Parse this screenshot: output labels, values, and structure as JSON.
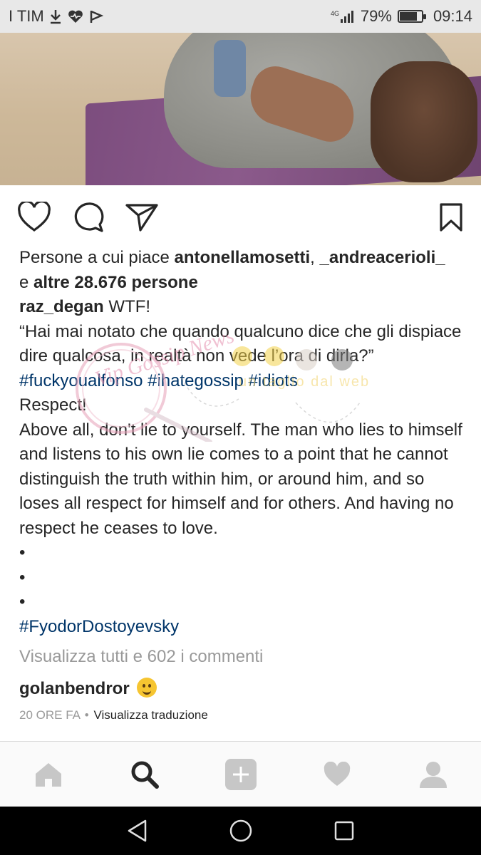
{
  "status_bar": {
    "carrier": "I TIM",
    "network": "4G",
    "battery_percent": "79%",
    "battery_level": 0.79,
    "time": "09:14"
  },
  "post": {
    "likes": {
      "prefix": "Persone a cui piace ",
      "user1": "antonellamosetti",
      "comma": ", ",
      "user2": "_andreacerioli_",
      "conjunction": "e ",
      "others": "altre 28.676 persone"
    },
    "caption": {
      "username": "raz_degan",
      "first_line": " WTF!",
      "quote": "“Hai mai notato che quando qualcuno dice che gli dispiace dire qualcosa, in realtà non vede l’ora di dirla?”",
      "hashtags_1": [
        "#fuckyoualfonso",
        "#ihategossip",
        "#idiots"
      ],
      "respect": "Respect!",
      "body": "Above all, don't lie to yourself. The man who lies to himself and listens to his own lie comes to a point that he cannot distinguish the truth within him, or around him, and so loses all respect for himself and for others. And having no respect he ceases to love.",
      "dots": [
        "•",
        "•",
        "•"
      ],
      "closing_hashtag": "#FyodorDostoyevsky"
    },
    "view_all_comments": "Visualizza tutti e 602 i commenti",
    "comment": {
      "username": "golanbendror",
      "emoji": "smiling-face-emoji"
    },
    "timestamp": "20 ORE FA",
    "separator": "•",
    "translate": "Visualizza traduzione"
  },
  "watermark": {
    "text1": "Vip Gossip News",
    "text2": "un taglio dal web"
  },
  "colors": {
    "hashtag": "#003569",
    "text": "#262626",
    "muted": "#999999",
    "tab_icon": "#c7c7c7",
    "tab_icon_active": "#262626"
  },
  "tab_bar": {
    "tabs": [
      {
        "name": "home-icon",
        "active": false
      },
      {
        "name": "search-icon",
        "active": true
      },
      {
        "name": "add-post-icon",
        "active": false
      },
      {
        "name": "heart-icon",
        "active": false
      },
      {
        "name": "profile-icon",
        "active": false
      }
    ]
  },
  "android_nav": [
    "back-icon",
    "home-circle-icon",
    "recents-icon"
  ]
}
